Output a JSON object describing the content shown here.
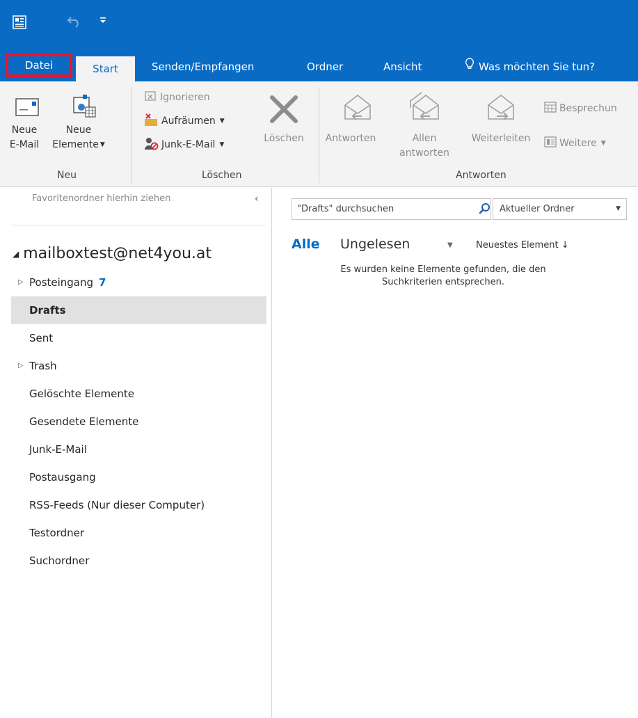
{
  "ribbon_tabs": {
    "file": "Datei",
    "start": "Start",
    "send_receive": "Senden/Empfangen",
    "folder": "Ordner",
    "view": "Ansicht",
    "tell_me": "Was möchten Sie tun?"
  },
  "ribbon": {
    "new_email_line1": "Neue",
    "new_email_line2": "E-Mail",
    "new_items_line1": "Neue",
    "new_items_line2": "Elemente",
    "group_new": "Neu",
    "ignore": "Ignorieren",
    "cleanup": "Aufräumen",
    "junk": "Junk-E-Mail",
    "delete": "Löschen",
    "group_delete": "Löschen",
    "reply": "Antworten",
    "reply_all_line1": "Allen",
    "reply_all_line2": "antworten",
    "forward": "Weiterleiten",
    "meeting": "Besprechun",
    "more": "Weitere",
    "group_respond": "Antworten"
  },
  "folder_pane": {
    "favorites_hint": "Favoritenordner hierhin ziehen",
    "collapse": "‹",
    "account": "mailboxtest@net4you.at",
    "folders": [
      {
        "name": "Posteingang",
        "count": "7"
      },
      {
        "name": "Drafts"
      },
      {
        "name": "Sent"
      },
      {
        "name": "Trash"
      },
      {
        "name": "Gelöschte Elemente"
      },
      {
        "name": "Gesendete Elemente"
      },
      {
        "name": "Junk-E-Mail"
      },
      {
        "name": "Postausgang"
      },
      {
        "name": "RSS-Feeds (Nur dieser Computer)"
      },
      {
        "name": "Testordner"
      },
      {
        "name": "Suchordner"
      }
    ]
  },
  "list_pane": {
    "search_value": "\"Drafts\" durchsuchen",
    "scope": "Aktueller Ordner",
    "filter_all": "Alle",
    "filter_unread": "Ungelesen",
    "sort": "Neuestes Element ↓",
    "empty_line1": "Es wurden keine Elemente gefunden, die den",
    "empty_line2": "Suchkriterien entsprechen."
  },
  "colors": {
    "accent": "#0a6bc4",
    "highlight_border": "#e8152f",
    "selected_folder_bg": "#e1e1e1"
  }
}
